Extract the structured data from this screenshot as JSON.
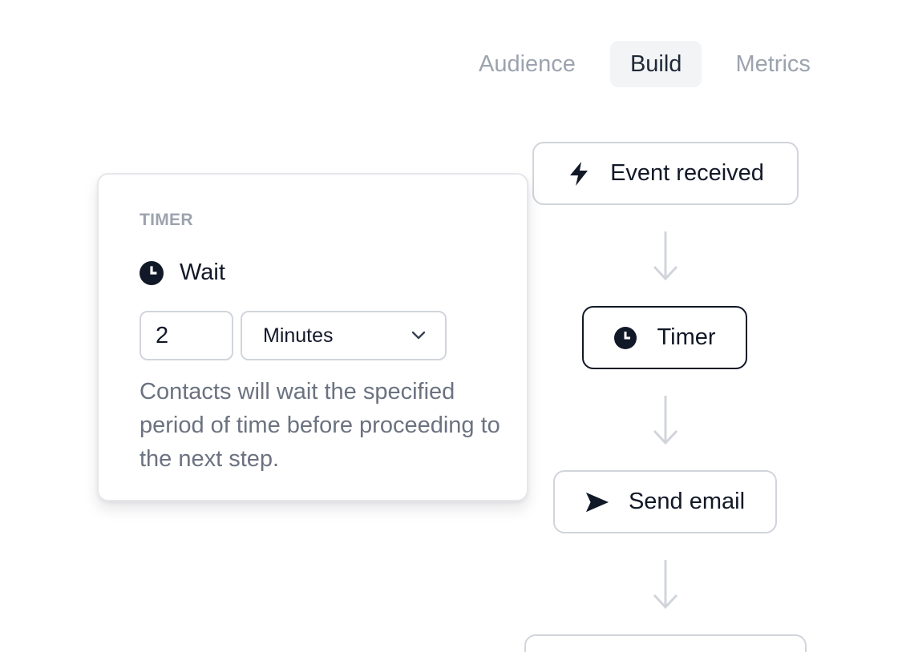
{
  "tabs": [
    {
      "label": "Audience",
      "active": false
    },
    {
      "label": "Build",
      "active": true
    },
    {
      "label": "Metrics",
      "active": false
    }
  ],
  "flow": {
    "nodes": [
      {
        "label": "Event received",
        "icon": "lightning-bolt-icon"
      },
      {
        "label": "Timer",
        "icon": "clock-icon",
        "selected": true
      },
      {
        "label": "Send email",
        "icon": "paper-plane-icon"
      }
    ]
  },
  "popover": {
    "kicker": "TIMER",
    "title": "Wait",
    "title_icon": "clock-icon",
    "duration_value": "2",
    "unit_selected": "Minutes",
    "help_text": "Contacts will wait the specified period of time before proceeding to the next step."
  },
  "colors": {
    "text": "#111827",
    "muted": "#6b7280",
    "border": "#d1d5db",
    "active_tab_bg": "#f3f4f6"
  }
}
